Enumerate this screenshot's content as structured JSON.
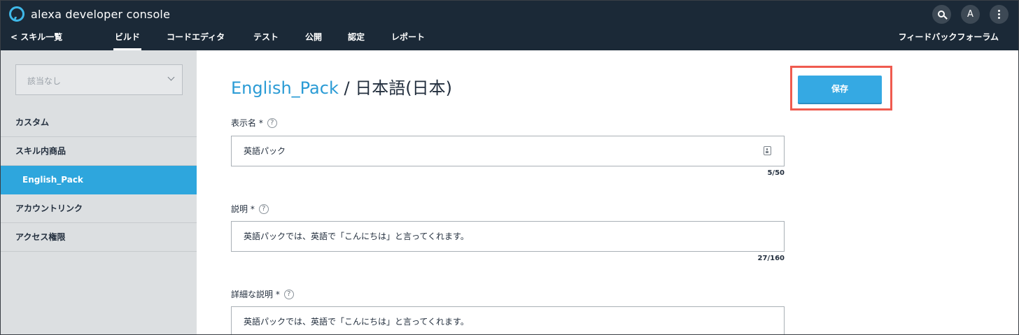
{
  "header": {
    "app_title": "alexa developer console",
    "avatar_initial": "A",
    "colors": {
      "bar": "#1b2937",
      "accent": "#2ea6dd",
      "highlight": "#ef5b4f"
    }
  },
  "nav": {
    "back_label": "スキル一覧",
    "tabs": [
      {
        "label": "ビルド",
        "active": true
      },
      {
        "label": "コードエディタ"
      },
      {
        "label": "テスト"
      },
      {
        "label": "公開"
      },
      {
        "label": "認定"
      },
      {
        "label": "レポート"
      }
    ],
    "right_link": "フィードバックフォーラム"
  },
  "sidebar": {
    "select_value": "該当なし",
    "items": [
      {
        "label": "カスタム"
      },
      {
        "label": "スキル内商品"
      },
      {
        "label": "English_Pack",
        "active": true
      },
      {
        "label": "アカウントリンク"
      },
      {
        "label": "アクセス権限"
      }
    ]
  },
  "main": {
    "title_link": "English_Pack",
    "title_separator": " / ",
    "title_locale": "日本語(日本)",
    "save_label": "保存",
    "fields": [
      {
        "label": "表示名 *",
        "value": "英語パック",
        "counter": "5/50"
      },
      {
        "label": "説明 *",
        "value": "英語パックでは、英語で「こんにちは」と言ってくれます。",
        "counter": "27/160"
      },
      {
        "label": "詳細な説明 *",
        "value": "英語パックでは、英語で「こんにちは」と言ってくれます。"
      }
    ]
  }
}
